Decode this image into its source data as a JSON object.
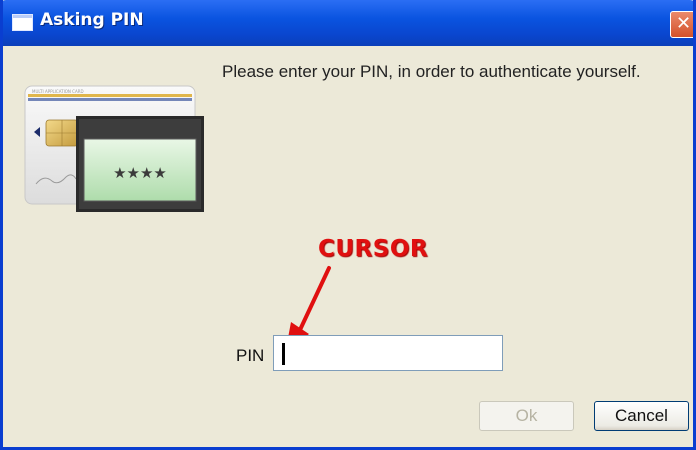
{
  "window": {
    "title": "Asking PIN",
    "close_glyph": "✕",
    "icon": "window-icon"
  },
  "dialog": {
    "message": "Please enter your PIN, in order to authenticate yourself.",
    "illustration": "smart-card-with-pin-reader-icon",
    "pin_label": "PIN",
    "pin_value": "",
    "ok_label": "Ok",
    "cancel_label": "Cancel",
    "ok_enabled": false
  },
  "annotation": {
    "text": "CURSOR",
    "color": "#e01010"
  },
  "colors": {
    "titlebar": "#0a54e0",
    "dialog_bg": "#ece9d8",
    "close_button": "#d4512b"
  }
}
